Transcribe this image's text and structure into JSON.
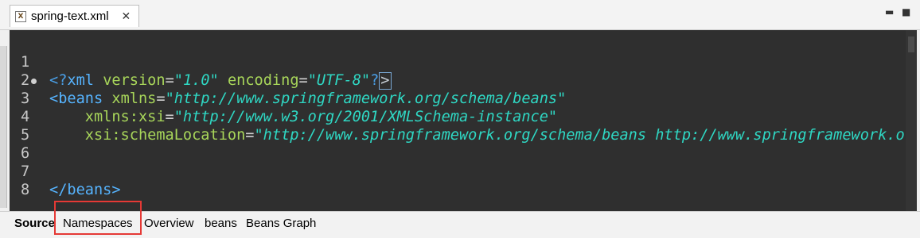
{
  "editor_tab": {
    "title": "spring-text.xml",
    "close_glyph": "✕",
    "icon": "xml-file-icon"
  },
  "window_controls": {
    "minimize_glyph": "▬",
    "maximize_glyph": "■"
  },
  "code": {
    "line_numbers": [
      "1",
      "2",
      "3",
      "4",
      "5",
      "6",
      "7",
      "8"
    ],
    "line1": {
      "pi_open": "<?",
      "tag": "xml",
      "attr1": "version",
      "eq1": "=",
      "val1": "\"1.0\"",
      "attr2": "encoding",
      "eq2": "=",
      "val2": "\"UTF-8\"",
      "pi_close": "?",
      "cursor": ">"
    },
    "line2": {
      "tag_open": "<beans",
      "attr": "xmlns",
      "eq": "=",
      "val": "\"http://www.springframework.org/schema/beans\""
    },
    "line3": {
      "attr": "xmlns:xsi",
      "eq": "=",
      "val": "\"http://www.w3.org/2001/XMLSchema-instance\""
    },
    "line4": {
      "attr": "xsi:schemaLocation",
      "eq": "=",
      "val": "\"http://www.springframework.org/schema/beans http://www.springframework.org"
    },
    "line7": {
      "tag_close": "</beans>"
    }
  },
  "bottom_tabs": [
    "Source",
    "Namespaces",
    "Overview",
    "beans",
    "Beans Graph"
  ],
  "colors": {
    "editor_background": "#2f2f2f",
    "xml_tag": "#56b4ff",
    "attribute": "#a8d65a",
    "value": "#2fd8c4",
    "highlight_box": "#e53935"
  }
}
